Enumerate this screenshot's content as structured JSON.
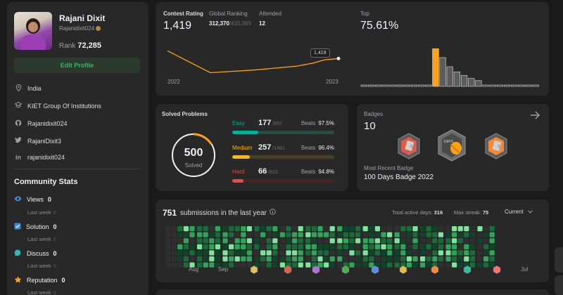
{
  "profile": {
    "name": "Rajani Dixit",
    "handle": "Rajanidixit024",
    "rank_label": "Rank",
    "rank_value": "72,285",
    "edit_label": "Edit Profile",
    "info": [
      {
        "icon": "location-icon",
        "text": "India"
      },
      {
        "icon": "school-icon",
        "text": "KIET Group Of Institutions"
      },
      {
        "icon": "github-icon",
        "text": "Rajanidixit024"
      },
      {
        "icon": "twitter-icon",
        "text": "RajaniDixit3"
      },
      {
        "icon": "linkedin-icon",
        "text": "rajanidixit024"
      }
    ]
  },
  "community": {
    "title": "Community Stats",
    "sub_label": "Last week",
    "stats": [
      {
        "icon": "eye-icon",
        "label": "Views",
        "value": "0",
        "delta": "0",
        "color": "#3c8ad6"
      },
      {
        "icon": "check-square-icon",
        "label": "Solution",
        "value": "0",
        "delta": "0",
        "color": "#3c8ad6"
      },
      {
        "icon": "chat-icon",
        "label": "Discuss",
        "value": "0",
        "delta": "0",
        "color": "#2cbbbb"
      },
      {
        "icon": "star-icon",
        "label": "Reputation",
        "value": "0",
        "delta": "0",
        "color": "#ffa116"
      }
    ]
  },
  "contest": {
    "rating_label": "Contest Rating",
    "rating": "1,419",
    "global_label": "Global Ranking",
    "global_rank": "312,370",
    "global_total": "/415,965",
    "attended_label": "Attended",
    "attended": "12",
    "tooltip": "1,419",
    "x_start": "2022",
    "x_end": "2023",
    "top_label": "Top",
    "top_value": "75.61%"
  },
  "solved": {
    "title": "Solved Problems",
    "total": "500",
    "total_label": "Solved",
    "beats_label": "Beats",
    "rows": [
      {
        "name": "Easy",
        "count": "177",
        "total": "/697",
        "beats": "97.5%",
        "color": "#00af9b",
        "track": "#2a4a42",
        "fraction": 0.254
      },
      {
        "name": "Medium",
        "count": "257",
        "total": "/1481",
        "beats": "96.4%",
        "color": "#ffb800",
        "track": "#4a3f1f",
        "fraction": 0.174
      },
      {
        "name": "Hard",
        "count": "66",
        "total": "/613",
        "beats": "94.8%",
        "color": "#ef4743",
        "track": "#4a2424",
        "fraction": 0.108
      }
    ]
  },
  "badges": {
    "title": "Badges",
    "count": "10",
    "recent_label": "Most Recent Badge",
    "recent_name": "100 Days Badge 2022",
    "items": [
      {
        "icon": "badge-hexagon-red-icon",
        "text": "6"
      },
      {
        "icon": "badge-100-days-icon",
        "text": "DAYS"
      },
      {
        "icon": "badge-hexagon-orange-icon",
        "text": "5"
      }
    ]
  },
  "submissions": {
    "count": "751",
    "label": "submissions in the last year",
    "active_label": "Total active days:",
    "active_value": "316",
    "streak_label": "Max streak:",
    "streak_value": "75",
    "period": "Current",
    "months": [
      "Aug",
      "Sep",
      "Jul"
    ]
  },
  "chart_data": {
    "type": "line",
    "x": [
      2022.0,
      2022.25,
      2022.5,
      2022.75,
      2022.85,
      2022.92,
      2023.0
    ],
    "values": [
      1500,
      1415,
      1425,
      1440,
      1452,
      1465,
      1470
    ],
    "xlabel": "",
    "ylabel": "",
    "histogram": [
      0,
      0,
      0,
      0,
      0,
      0,
      0,
      0,
      0,
      0,
      1,
      0.75,
      0.5,
      0.36,
      0.26,
      0.18,
      0.12,
      0,
      0,
      0,
      0,
      0,
      0,
      0,
      0
    ],
    "highlight_index": 10
  }
}
